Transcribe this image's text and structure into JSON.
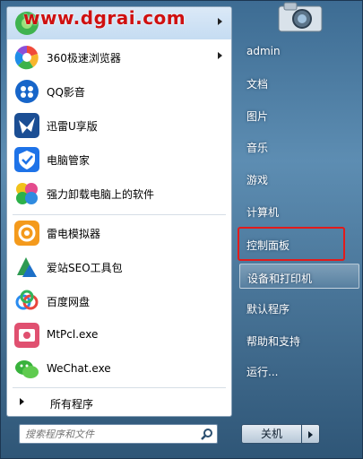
{
  "watermark": "www.dgrai.com",
  "programs": [
    {
      "label": "",
      "has_arrow": true,
      "icon": "green-app-icon"
    },
    {
      "label": "360极速浏览器",
      "has_arrow": true,
      "icon": "360-browser-icon"
    },
    {
      "label": "QQ影音",
      "has_arrow": false,
      "icon": "qq-player-icon"
    },
    {
      "label": "迅雷U享版",
      "has_arrow": false,
      "icon": "xunlei-icon"
    },
    {
      "label": "电脑管家",
      "has_arrow": false,
      "icon": "pc-manager-icon"
    },
    {
      "label": "强力卸载电脑上的软件",
      "has_arrow": false,
      "icon": "uninstaller-icon"
    },
    {
      "label": "雷电模拟器",
      "has_arrow": false,
      "icon": "ldplayer-icon"
    },
    {
      "label": "爱站SEO工具包",
      "has_arrow": false,
      "icon": "seo-toolkit-icon"
    },
    {
      "label": "百度网盘",
      "has_arrow": false,
      "icon": "baidu-netdisk-icon"
    },
    {
      "label": "MtPcl.exe",
      "has_arrow": false,
      "icon": "mtpcl-icon"
    },
    {
      "label": "WeChat.exe",
      "has_arrow": false,
      "icon": "wechat-icon"
    }
  ],
  "all_programs": "所有程序",
  "search_placeholder": "搜索程序和文件",
  "right_items": [
    {
      "label": "admin"
    },
    {
      "label": "文档"
    },
    {
      "label": "图片"
    },
    {
      "label": "音乐"
    },
    {
      "label": "游戏"
    },
    {
      "label": "计算机"
    },
    {
      "label": "控制面板"
    },
    {
      "label": "设备和打印机"
    },
    {
      "label": "默认程序"
    },
    {
      "label": "帮助和支持"
    },
    {
      "label": "运行..."
    }
  ],
  "shutdown_label": "关机",
  "colors": {
    "highlight_box": "#e21b1b",
    "menu_blue": "#3d6c93"
  }
}
